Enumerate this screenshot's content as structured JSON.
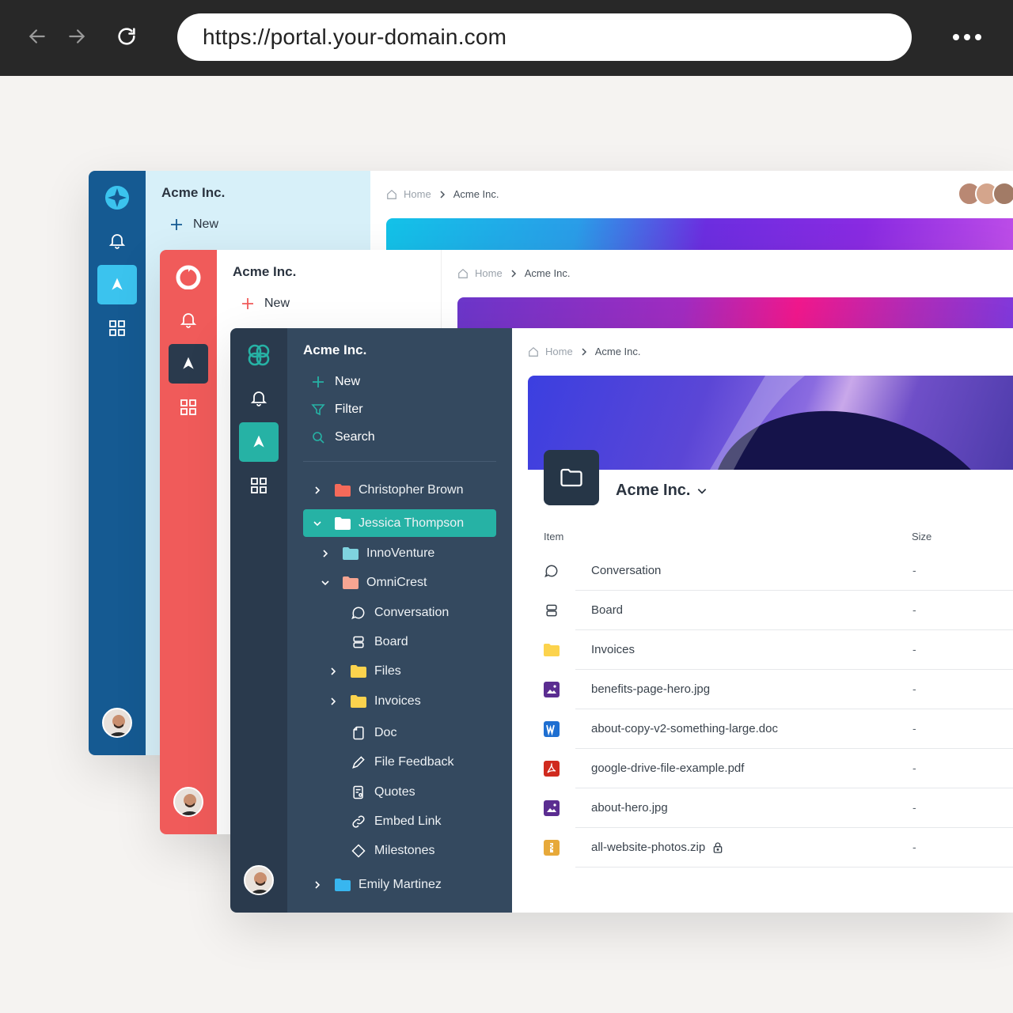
{
  "browser": {
    "url": "https://portal.your-domain.com"
  },
  "colors": {
    "blue_rail": "#155a92",
    "red_rail": "#f05b5a",
    "dark_rail": "#2a3a4d",
    "teal_accent": "#26b2a5"
  },
  "window_blue": {
    "org_name": "Acme Inc.",
    "actions": [
      {
        "label": "New",
        "icon": "plus-icon"
      }
    ],
    "breadcrumb": {
      "home": "Home",
      "current": "Acme Inc."
    }
  },
  "window_red": {
    "org_name": "Acme Inc.",
    "actions": [
      {
        "label": "New",
        "icon": "plus-icon"
      }
    ],
    "breadcrumb": {
      "home": "Home",
      "current": "Acme Inc."
    }
  },
  "window_dark": {
    "org_name": "Acme Inc.",
    "actions": [
      {
        "label": "New",
        "icon": "plus-icon"
      },
      {
        "label": "Filter",
        "icon": "filter-icon"
      },
      {
        "label": "Search",
        "icon": "search-icon"
      }
    ],
    "tree": [
      {
        "label": "Christopher Brown",
        "icon": "folder-icon",
        "expanded": false
      },
      {
        "label": "Jessica Thompson",
        "icon": "folder-icon",
        "expanded": true,
        "selected": true
      },
      {
        "label": "InnoVenture",
        "icon": "folder-icon",
        "expanded": false
      },
      {
        "label": "OmniCrest",
        "icon": "folder-icon",
        "expanded": true
      },
      {
        "label": "Conversation",
        "icon": "chat-icon"
      },
      {
        "label": "Board",
        "icon": "board-icon"
      },
      {
        "label": "Files",
        "icon": "folder-icon",
        "expanded": false
      },
      {
        "label": "Invoices",
        "icon": "folder-icon",
        "expanded": false
      },
      {
        "label": "Doc",
        "icon": "doc-icon"
      },
      {
        "label": "File Feedback",
        "icon": "pen-icon"
      },
      {
        "label": "Quotes",
        "icon": "quotes-icon"
      },
      {
        "label": "Embed Link",
        "icon": "link-icon"
      },
      {
        "label": "Milestones",
        "icon": "diamond-icon"
      },
      {
        "label": "Emily Martinez",
        "icon": "folder-icon",
        "expanded": false
      }
    ],
    "breadcrumb": {
      "home": "Home",
      "current": "Acme Inc."
    },
    "folder_title": "Acme Inc.",
    "table": {
      "headers": [
        "Item",
        "Size"
      ],
      "rows": [
        {
          "name": "Conversation",
          "size": "-",
          "icon": "chat-icon"
        },
        {
          "name": "Board",
          "size": "-",
          "icon": "board-icon"
        },
        {
          "name": "Invoices",
          "size": "-",
          "icon": "folder-icon"
        },
        {
          "name": "benefits-page-hero.jpg",
          "size": "-",
          "icon": "image-file-icon"
        },
        {
          "name": "about-copy-v2-something-large.doc",
          "size": "-",
          "icon": "word-file-icon"
        },
        {
          "name": "google-drive-file-example.pdf",
          "size": "-",
          "icon": "pdf-file-icon"
        },
        {
          "name": "about-hero.jpg",
          "size": "-",
          "icon": "image-file-icon"
        },
        {
          "name": "all-website-photos.zip",
          "size": "-",
          "icon": "zip-file-icon",
          "locked": true
        }
      ]
    }
  }
}
